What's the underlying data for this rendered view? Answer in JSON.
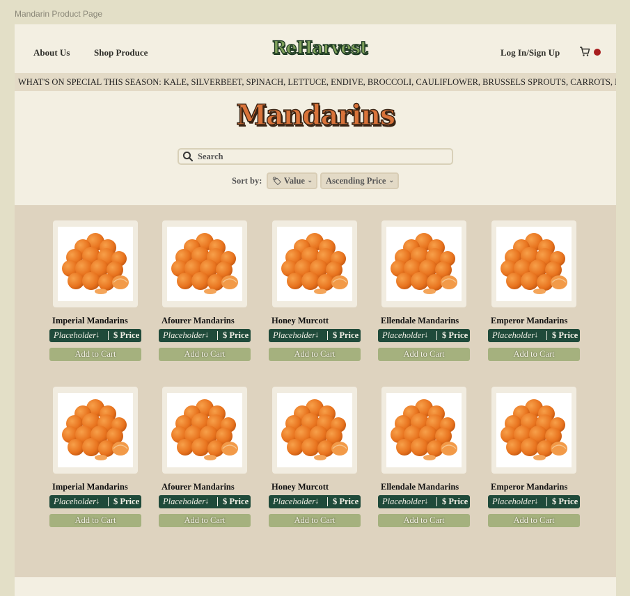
{
  "window": {
    "title": "Mandarin Product Page"
  },
  "header": {
    "nav": [
      "About Us",
      "Shop Produce"
    ],
    "logo": "ReHarvest",
    "login": "Log In/Sign Up",
    "cart_icon": "cart-icon",
    "badge_color": "#a81e1e"
  },
  "ticker": {
    "text": "WHAT'S ON SPECIAL THIS SEASON: KALE, SILVERBEET, SPINACH, LETTUCE, ENDIVE, BROCCOLI, CAULIFLOWER, BRUSSELS SPROUTS, CARROTS, BEETROOT"
  },
  "page_title": "Mandarins",
  "search": {
    "placeholder": "Search",
    "icon": "search-icon"
  },
  "sort": {
    "label": "Sort by:",
    "field": {
      "icon": "price-tag-icon",
      "value": "Value"
    },
    "order": "Ascending Price"
  },
  "products": [
    {
      "name": "Imperial Mandarins",
      "option": "Placeholder",
      "price": "$ Price",
      "cta": "Add to Cart"
    },
    {
      "name": "Afourer Mandarins",
      "option": "Placeholder",
      "price": "$ Price",
      "cta": "Add to Cart"
    },
    {
      "name": "Honey Murcott",
      "option": "Placeholder",
      "price": "$ Price",
      "cta": "Add to Cart"
    },
    {
      "name": "Ellendale Mandarins",
      "option": "Placeholder",
      "price": "$ Price",
      "cta": "Add to Cart"
    },
    {
      "name": "Emperor Mandarins",
      "option": "Placeholder",
      "price": "$ Price",
      "cta": "Add to Cart"
    },
    {
      "name": "Imperial Mandarins",
      "option": "Placeholder",
      "price": "$ Price",
      "cta": "Add to Cart"
    },
    {
      "name": "Afourer Mandarins",
      "option": "Placeholder",
      "price": "$ Price",
      "cta": "Add to Cart"
    },
    {
      "name": "Honey Murcott",
      "option": "Placeholder",
      "price": "$ Price",
      "cta": "Add to Cart"
    },
    {
      "name": "Ellendale Mandarins",
      "option": "Placeholder",
      "price": "$ Price",
      "cta": "Add to Cart"
    },
    {
      "name": "Emperor Mandarins",
      "option": "Placeholder",
      "price": "$ Price",
      "cta": "Add to Cart"
    }
  ],
  "colors": {
    "page_bg": "#f3efe2",
    "grid_bg": "#ded3bf",
    "option_bar": "#1f4a3a",
    "add_button": "#a5b17e",
    "title_orange": "#d9733a",
    "logo_green": "#7ea05a"
  }
}
